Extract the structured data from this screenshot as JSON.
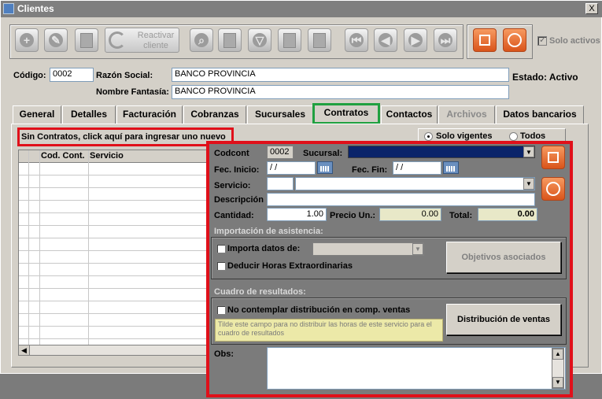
{
  "window": {
    "title": "Clientes",
    "close_glyph": "X"
  },
  "toolbar": {
    "reactivar_label_1": "Reactivar",
    "reactivar_label_2": "cliente",
    "solo_activos_label": "Solo activos",
    "solo_activos_checked": true,
    "icons": [
      "add-icon",
      "edit-icon",
      "delete-icon",
      "reactivate-icon",
      "search-icon",
      "sort-az-icon",
      "filter-icon",
      "list-icon",
      "print-icon",
      "first-icon",
      "prev-icon",
      "next-icon",
      "last-icon",
      "save-icon",
      "cancel-icon"
    ]
  },
  "header": {
    "codigo_label": "Código:",
    "codigo_value": "0002",
    "razon_label": "Razón Social:",
    "razon_value": "BANCO PROVINCIA",
    "fantasia_label": "Nombre Fantasía:",
    "fantasia_value": "BANCO PROVINCIA",
    "estado": "Estado: Activo"
  },
  "tabs": [
    {
      "label": "General"
    },
    {
      "label": "Detalles"
    },
    {
      "label": "Facturación"
    },
    {
      "label": "Cobranzas"
    },
    {
      "label": "Sucursales"
    },
    {
      "label": "Contratos"
    },
    {
      "label": "Contactos"
    },
    {
      "label": "Archivos"
    },
    {
      "label": "Datos bancarios"
    }
  ],
  "contracts": {
    "empty_banner": "Sin Contratos, click aquí para ingresar uno nuevo",
    "radio_vigentes": "Solo vigentes",
    "radio_todos": "Todos",
    "columns": [
      "Cod. Cont.",
      "Servicio"
    ]
  },
  "form": {
    "codcont_label": "Codcont",
    "codcont_value": "0002",
    "sucursal_label": "Sucursal:",
    "fec_inicio_label": "Fec. Inicio:",
    "fec_inicio_value": "/ /",
    "fec_fin_label": "Fec. Fin:",
    "fec_fin_value": "/ /",
    "servicio_label": "Servicio:",
    "descripcion_label": "Descripción",
    "cantidad_label": "Cantidad:",
    "cantidad_value": "1.00",
    "precio_label": "Precio Un.:",
    "precio_value": "0.00",
    "total_label": "Total:",
    "total_value": "0.00",
    "importacion_title": "Importación de asistencia:",
    "importa_label": "Importa datos de:",
    "deducir_label": "Deducir Horas Extraordinarias",
    "objetivos_button": "Objetivos asociados",
    "cuadro_title": "Cuadro de resultados:",
    "no_contemplar_label": "No contemplar distribución en comp. ventas",
    "tip_text": "Tilde este campo para no distribuir las horas de este servicio para el cuadro de resultados",
    "distribucion_button": "Distribución de ventas",
    "obs_label": "Obs:"
  },
  "colors": {
    "highlight_red": "#e0101a",
    "highlight_green": "#20a040",
    "action_orange": "#e06020",
    "overlay_bg": "#7b7b7b"
  }
}
